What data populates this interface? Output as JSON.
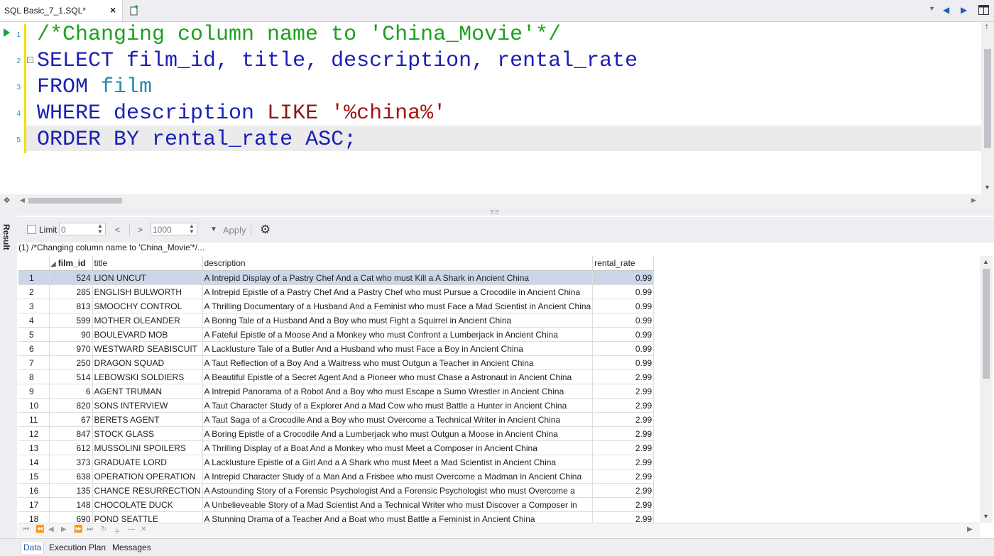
{
  "tab": {
    "title": "SQL Basic_7_1.SQL*",
    "close": "×"
  },
  "editor": {
    "line_numbers": [
      "1",
      "2",
      "3",
      "4",
      "5"
    ],
    "lines": [
      {
        "tokens": [
          {
            "text": "/*Changing column name to 'China_Movie'*/",
            "cls": "c-comment"
          }
        ]
      },
      {
        "tokens": [
          {
            "text": "SELECT",
            "cls": "c-kw"
          },
          {
            "text": " film_id, title, description, rental_rate",
            "cls": "c-id"
          }
        ]
      },
      {
        "tokens": [
          {
            "text": "FROM",
            "cls": "c-kw"
          },
          {
            "text": " film",
            "cls": "c-tbl"
          }
        ]
      },
      {
        "tokens": [
          {
            "text": "WHERE",
            "cls": "c-kw"
          },
          {
            "text": " description ",
            "cls": "c-id"
          },
          {
            "text": "LIKE",
            "cls": "c-like"
          },
          {
            "text": " '%china%'",
            "cls": "c-str"
          }
        ]
      },
      {
        "tokens": [
          {
            "text": "ORDER BY",
            "cls": "c-kw"
          },
          {
            "text": " rental_rate ",
            "cls": "c-id"
          },
          {
            "text": "ASC",
            "cls": "c-kw"
          },
          {
            "text": ";",
            "cls": "c-id"
          }
        ]
      }
    ]
  },
  "result": {
    "side_label": "Result",
    "toolbar": {
      "limit_label": "Limit",
      "limit_from": "0",
      "limit_count": "1000",
      "apply_label": "Apply"
    },
    "query_label": "(1) /*Changing column name to 'China_Movie'*/...",
    "columns": [
      "film_id",
      "title",
      "description",
      "rental_rate"
    ],
    "rows": [
      [
        "1",
        "524",
        "LION UNCUT",
        "A Intrepid Display of a Pastry Chef And a Cat who must Kill a A Shark in Ancient China",
        "0.99"
      ],
      [
        "2",
        "285",
        "ENGLISH BULWORTH",
        "A Intrepid Epistle of a Pastry Chef And a Pastry Chef who must Pursue a Crocodile in Ancient China",
        "0.99"
      ],
      [
        "3",
        "813",
        "SMOOCHY CONTROL",
        "A Thrilling Documentary of a Husband And a Feminist who must Face a Mad Scientist in Ancient China",
        "0.99"
      ],
      [
        "4",
        "599",
        "MOTHER OLEANDER",
        "A Boring Tale of a Husband And a Boy who must Fight a Squirrel in Ancient China",
        "0.99"
      ],
      [
        "5",
        "90",
        "BOULEVARD MOB",
        "A Fateful Epistle of a Moose And a Monkey who must Confront a Lumberjack in Ancient China",
        "0.99"
      ],
      [
        "6",
        "970",
        "WESTWARD SEABISCUIT",
        "A Lacklusture Tale of a Butler And a Husband who must Face a Boy in Ancient China",
        "0.99"
      ],
      [
        "7",
        "250",
        "DRAGON SQUAD",
        "A Taut Reflection of a Boy And a Waitress who must Outgun a Teacher in Ancient China",
        "0.99"
      ],
      [
        "8",
        "514",
        "LEBOWSKI SOLDIERS",
        "A Beautiful Epistle of a Secret Agent And a Pioneer who must Chase a Astronaut in Ancient China",
        "2.99"
      ],
      [
        "9",
        "6",
        "AGENT TRUMAN",
        "A Intrepid Panorama of a Robot And a Boy who must Escape a Sumo Wrestler in Ancient China",
        "2.99"
      ],
      [
        "10",
        "820",
        "SONS INTERVIEW",
        "A Taut Character Study of a Explorer And a Mad Cow who must Battle a Hunter in Ancient China",
        "2.99"
      ],
      [
        "11",
        "67",
        "BERETS AGENT",
        "A Taut Saga of a Crocodile And a Boy who must Overcome a Technical Writer in Ancient China",
        "2.99"
      ],
      [
        "12",
        "847",
        "STOCK GLASS",
        "A Boring Epistle of a Crocodile And a Lumberjack who must Outgun a Moose in Ancient China",
        "2.99"
      ],
      [
        "13",
        "612",
        "MUSSOLINI SPOILERS",
        "A Thrilling Display of a Boat And a Monkey who must Meet a Composer in Ancient China",
        "2.99"
      ],
      [
        "14",
        "373",
        "GRADUATE LORD",
        "A Lacklusture Epistle of a Girl And a A Shark who must Meet a Mad Scientist in Ancient China",
        "2.99"
      ],
      [
        "15",
        "638",
        "OPERATION OPERATION",
        "A Intrepid Character Study of a Man And a Frisbee who must Overcome a Madman in Ancient China",
        "2.99"
      ],
      [
        "16",
        "135",
        "CHANCE RESURRECTION",
        "A Astounding Story of a Forensic Psychologist And a Forensic Psychologist who must Overcome a",
        "2.99"
      ],
      [
        "17",
        "148",
        "CHOCOLATE DUCK",
        "A Unbelieveable Story of a Mad Scientist And a Technical Writer who must Discover a Composer in",
        "2.99"
      ],
      [
        "18",
        "690",
        "POND SEATTLE",
        "A Stunning Drama of a Teacher And a Boat who must Battle a Feminist in Ancient China",
        "2.99"
      ]
    ],
    "selected_row": 0
  },
  "bottom_tabs": [
    {
      "label": "Data",
      "active": true
    },
    {
      "label": "Execution Plan",
      "active": false
    },
    {
      "label": "Messages",
      "active": false
    }
  ]
}
